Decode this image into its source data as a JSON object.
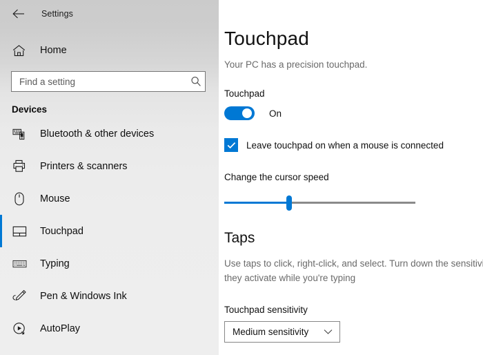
{
  "sidebar": {
    "back_icon": "back-arrow-icon",
    "title": "Settings",
    "home": {
      "label": "Home",
      "icon": "home-icon"
    },
    "search": {
      "placeholder": "Find a setting",
      "value": "",
      "icon": "search-icon"
    },
    "group_title": "Devices",
    "items": [
      {
        "label": "Bluetooth & other devices",
        "icon": "devices-icon",
        "selected": false
      },
      {
        "label": "Printers & scanners",
        "icon": "printer-icon",
        "selected": false
      },
      {
        "label": "Mouse",
        "icon": "mouse-icon",
        "selected": false
      },
      {
        "label": "Touchpad",
        "icon": "touchpad-icon",
        "selected": true
      },
      {
        "label": "Typing",
        "icon": "keyboard-icon",
        "selected": false
      },
      {
        "label": "Pen & Windows Ink",
        "icon": "pen-icon",
        "selected": false
      },
      {
        "label": "AutoPlay",
        "icon": "autoplay-icon",
        "selected": false
      }
    ]
  },
  "content": {
    "title": "Touchpad",
    "subtitle": "Your PC has a precision touchpad.",
    "touchpad": {
      "label": "Touchpad",
      "toggle_state": "On",
      "toggle_on": true
    },
    "leave_on": {
      "label": "Leave touchpad on when a mouse is connected",
      "checked": true,
      "check_icon": "checkmark-icon"
    },
    "cursor_speed": {
      "label": "Change the cursor speed",
      "percent": 34
    },
    "taps": {
      "heading": "Taps",
      "description": "Use taps to click, right-click, and select. Turn down the sensitivity if\nthey activate while you're typing",
      "sensitivity_label": "Touchpad sensitivity",
      "sensitivity_value": "Medium sensitivity",
      "chevron_icon": "chevron-down-icon"
    }
  },
  "colors": {
    "accent": "#0078d4",
    "sidebar_top": "#cbcbcb",
    "sidebar_bottom": "#eeeeee",
    "text": "#101010",
    "muted_text": "#6a6a6a"
  }
}
